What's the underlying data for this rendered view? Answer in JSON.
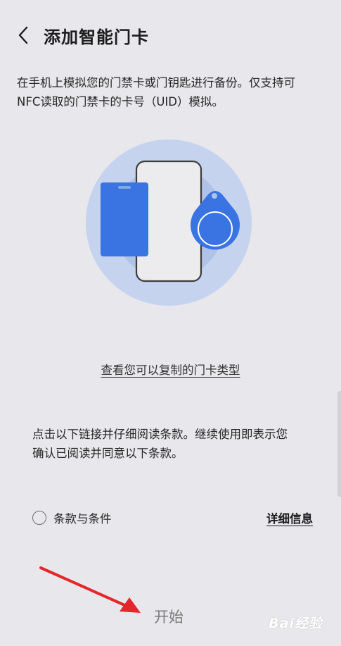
{
  "header": {
    "title": "添加智能门卡",
    "back_icon": "chevron-left-icon"
  },
  "description": {
    "line1": "在手机上模拟您的门禁卡或门钥匙进行备份。仅支持可",
    "line2": "NFC读取的门禁卡的卡号（UID）模拟。"
  },
  "illustration": {
    "icon": "phone-nfc-card-keyfob-illustration",
    "colors": {
      "outer_circle": "#c5d3ee",
      "inner_circle": "#afc2e8",
      "card": "#3a74e2",
      "phone_body": "#ececee",
      "phone_border": "#3c3c3c"
    }
  },
  "card_types_link": "查看您可以复制的门卡类型",
  "notice": {
    "line1": "点击以下链接并仔细阅读条款。继续使用即表示您",
    "line2": "确认已阅读并同意以下条款。"
  },
  "terms": {
    "checked": false,
    "label": "条款与条件",
    "details_link": "详细信息"
  },
  "start_button": "开始",
  "watermark": "Bai经验",
  "annotation": {
    "icon": "red-arrow-icon",
    "color": "#e5262a"
  }
}
